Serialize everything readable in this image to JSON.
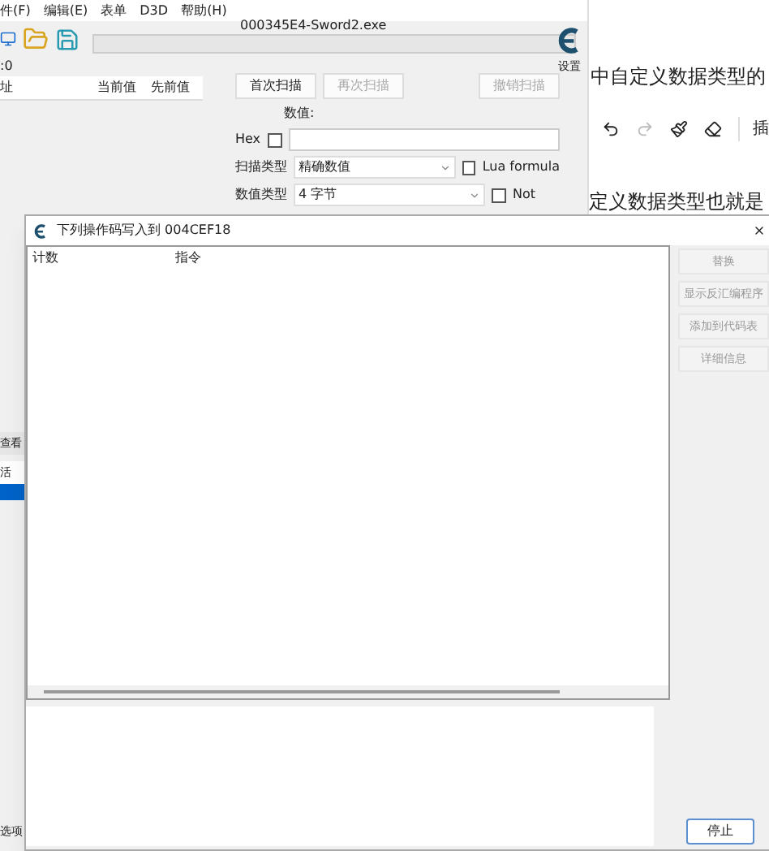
{
  "main_window": {
    "menu": [
      "件(F)",
      "编辑(E)",
      "表单",
      "D3D",
      "帮助(H)"
    ],
    "process_title": "000345E4-Sword2.exe",
    "progress": {
      "level": 0
    },
    "found_count": ":0",
    "settings_label": "设置",
    "columns": [
      "址",
      "当前值",
      "先前值"
    ],
    "scan_buttons": [
      {
        "label": "首次扫描",
        "disabled": false
      },
      {
        "label": "再次扫描",
        "disabled": true
      },
      {
        "label": "撤销扫描",
        "disabled": true
      }
    ],
    "value_label": "数值:",
    "hex": {
      "label": "Hex",
      "checked": false
    },
    "scan_type": {
      "label": "扫描类型",
      "value": "精确数值"
    },
    "value_type": {
      "label": "数值类型",
      "value": "4 字节"
    },
    "options": [
      {
        "label": "Lua formula",
        "checked": false
      },
      {
        "label": "Not",
        "checked": false
      }
    ],
    "view_button": "查看",
    "lower_columns": [
      "活"
    ],
    "options_label": "选项"
  },
  "editor": {
    "heading": "中自定义数据类型的",
    "insert_label": "插",
    "body": "定义数据类型也就是"
  },
  "dialog": {
    "title": "下列操作码写入到 004CEF18",
    "columns": [
      "计数",
      "指令"
    ],
    "buttons": [
      {
        "label": "替换",
        "disabled": true
      },
      {
        "label": "显示反汇编程序",
        "disabled": true
      },
      {
        "label": "添加到代码表",
        "disabled": true
      },
      {
        "label": "详细信息",
        "disabled": true
      }
    ],
    "stop_button": "停止"
  }
}
